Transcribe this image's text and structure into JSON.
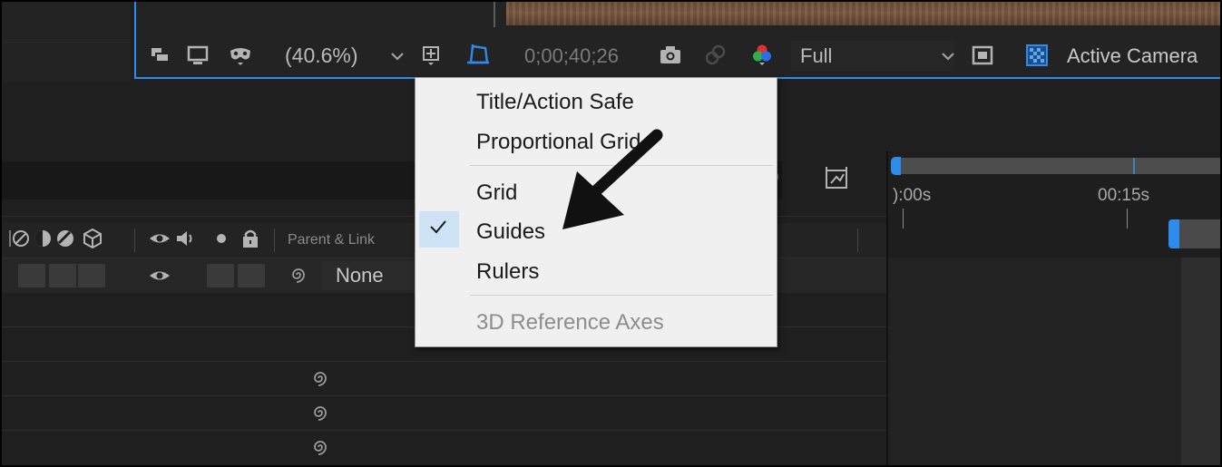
{
  "viewer": {
    "zoom_label": "(40.6%)",
    "timecode": "0;00;40;26",
    "resolution": "Full",
    "camera": "Active Camera",
    "accent_color": "#2d8ceb",
    "icons": [
      "always-preview-icon",
      "monitor-icon",
      "mask-icon",
      "zoom-chevron-icon",
      "grid-guide-options-icon",
      "toggle-mask-path-icon",
      "snapshot-camera-icon",
      "show-snapshot-icon",
      "color-channels-icon",
      "resolution-chevron-icon",
      "region-of-interest-icon",
      "transparency-grid-icon"
    ]
  },
  "menu": {
    "items": [
      {
        "label": "Title/Action Safe",
        "checked": false,
        "enabled": true
      },
      {
        "label": "Proportional Grid",
        "checked": false,
        "enabled": true
      },
      {
        "label": "Grid",
        "checked": false,
        "enabled": true
      },
      {
        "label": "Guides",
        "checked": true,
        "enabled": true
      },
      {
        "label": "Rulers",
        "checked": false,
        "enabled": true
      },
      {
        "label": "3D Reference Axes",
        "checked": false,
        "enabled": false
      }
    ]
  },
  "timeline": {
    "ruler_labels": [
      "):00s",
      "00:15s"
    ],
    "header": {
      "parent_link_label": "Parent & Link"
    },
    "layers": [
      {
        "parent": "None",
        "visible": true
      }
    ]
  }
}
